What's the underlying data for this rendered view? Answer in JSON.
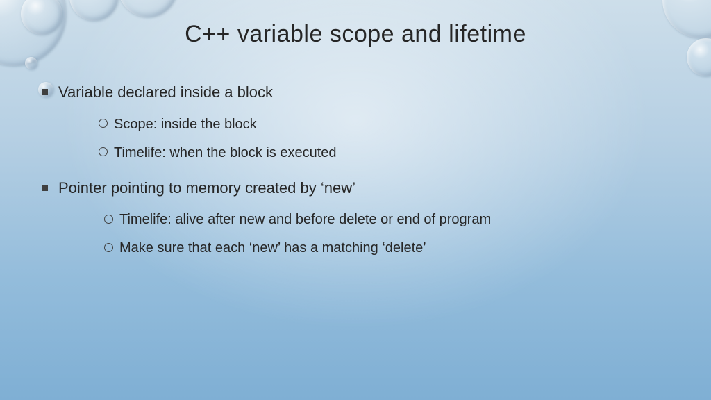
{
  "title": "C++ variable scope and lifetime",
  "bullets": [
    {
      "text": "Variable declared inside a block",
      "sub": [
        "Scope: inside the block",
        "Timelife: when the block is executed"
      ]
    },
    {
      "text": "Pointer pointing to memory created by ‘new’",
      "sub": [
        "Timelife: alive after new and before delete or end of program",
        "Make sure that each ‘new’ has a matching ‘delete’"
      ]
    }
  ]
}
